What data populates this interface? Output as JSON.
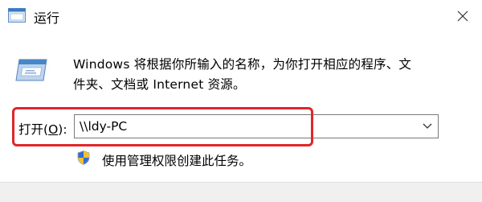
{
  "window": {
    "title": "运行",
    "close_icon": "close-icon"
  },
  "description": {
    "line1": "Windows 将根据你所输入的名称，为你打开相应的程序、文",
    "line2": "件夹、文档或 Internet 资源。"
  },
  "open_field": {
    "label_prefix": "打开(",
    "label_access_key": "O",
    "label_suffix": "):",
    "value": "\\\\ldy-PC"
  },
  "admin_note": "使用管理权限创建此任务。",
  "colors": {
    "highlight": "#e0252b",
    "footer": "#f0f0f0"
  }
}
